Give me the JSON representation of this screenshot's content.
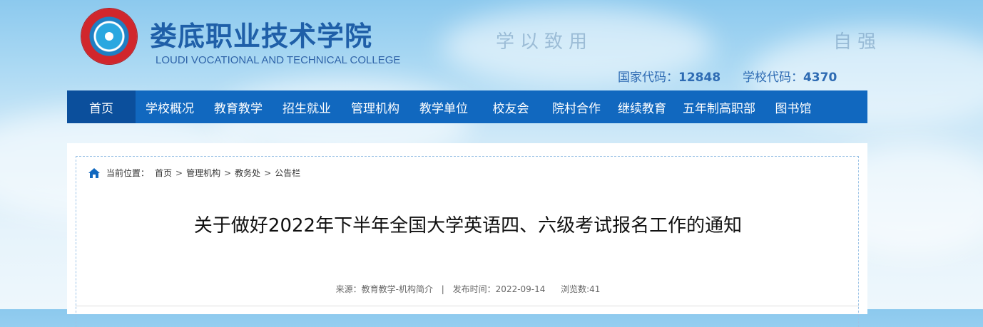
{
  "header": {
    "college_name_cn": "娄底职业技术学院",
    "college_name_en": "LOUDI VOCATIONAL AND TECHNICAL COLLEGE",
    "motto_left": "学以致用",
    "motto_right": "自强",
    "national_code_label": "国家代码：",
    "national_code": "12848",
    "school_code_label": "学校代码：",
    "school_code": "4370"
  },
  "nav": {
    "items": [
      {
        "label": "首页"
      },
      {
        "label": "学校概况"
      },
      {
        "label": "教育教学"
      },
      {
        "label": "招生就业"
      },
      {
        "label": "管理机构"
      },
      {
        "label": "教学单位"
      },
      {
        "label": "校友会"
      },
      {
        "label": "院村合作"
      },
      {
        "label": "继续教育"
      },
      {
        "label": "五年制高职部"
      },
      {
        "label": "图书馆"
      }
    ],
    "active_color": "#0b4f9c",
    "bg_color": "#1168bf"
  },
  "breadcrumb": {
    "prefix": "当前位置：",
    "items": [
      "首页",
      "管理机构",
      "教务处",
      "公告栏"
    ],
    "separator": ">"
  },
  "article": {
    "title": "关于做好2022年下半年全国大学英语四、六级考试报名工作的通知",
    "source_label": "来源：",
    "source": "教育教学-机构简介",
    "divider": "|",
    "date_label": "发布时间：",
    "date": "2022-09-14",
    "views_label": "浏览数:",
    "views": "41"
  }
}
